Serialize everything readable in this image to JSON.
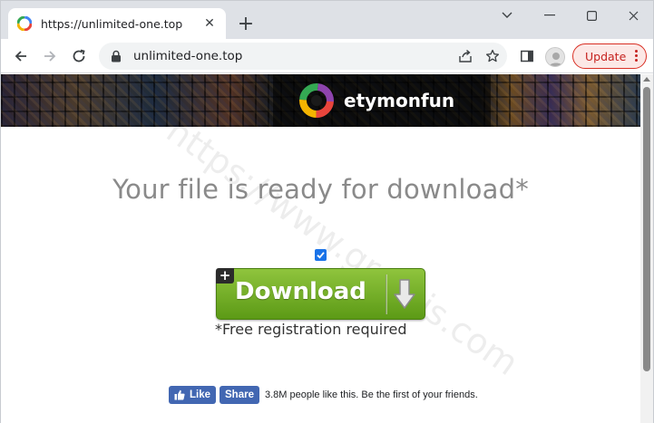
{
  "browser": {
    "tab": {
      "title": "https://unlimited-one.top",
      "close_icon": "close-icon"
    },
    "new_tab_label": "+",
    "address": {
      "url": "unlimited-one.top"
    },
    "update_label": "Update",
    "colors": {
      "frame": "#dee1e6",
      "update_border": "#d93025",
      "update_text": "#c5221f"
    }
  },
  "page": {
    "brand": {
      "name": "etymonfun"
    },
    "headline": "Your file is ready for download*",
    "agree_checkbox": {
      "checked": true
    },
    "download": {
      "label": "Download",
      "badge": "+"
    },
    "registration_note": "*Free registration required",
    "facebook": {
      "like_label": "Like",
      "share_label": "Share",
      "social_text": "3.8M people like this. Be the first of your friends."
    },
    "watermark": "https://www.greatis.com",
    "colors": {
      "download_green": "#6fae22",
      "headline_gray": "#8a8a8a",
      "facebook_blue": "#4267b2"
    }
  }
}
